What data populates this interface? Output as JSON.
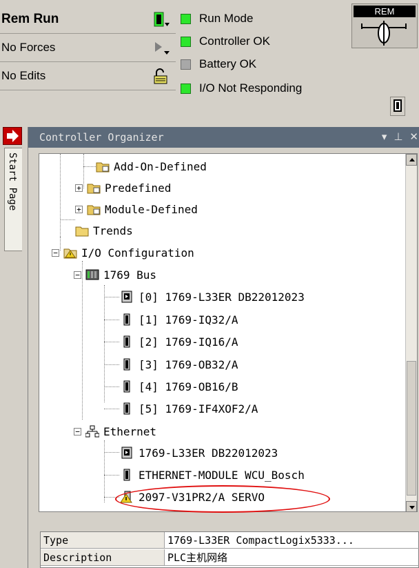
{
  "status": {
    "mode": "Rem Run",
    "forces": "No Forces",
    "edits": "No Edits",
    "leds": [
      {
        "label": "Run Mode",
        "color": "#2ce62c"
      },
      {
        "label": "Controller OK",
        "color": "#2ce62c"
      },
      {
        "label": "Battery OK",
        "color": "#a8a8a8"
      },
      {
        "label": "I/O Not Responding",
        "color": "#2ce62c"
      }
    ],
    "keyswitch_label": "REM"
  },
  "side_tab": {
    "label": "Start Page"
  },
  "organizer": {
    "title": "Controller Organizer",
    "title_buttons": [
      "▾",
      "⊥",
      "✕"
    ],
    "tree": {
      "add_on_defined": "Add-On-Defined",
      "predefined": "Predefined",
      "module_defined": "Module-Defined",
      "trends": "Trends",
      "io_config": "I/O Configuration",
      "bus": "1769 Bus",
      "bus_modules": [
        "[0] 1769-L33ER DB22012023",
        "[1] 1769-IQ32/A",
        "[2] 1769-IQ16/A",
        "[3] 1769-OB32/A",
        "[4] 1769-OB16/B",
        "[5] 1769-IF4XOF2/A"
      ],
      "ethernet": "Ethernet",
      "ethernet_modules": [
        "1769-L33ER DB22012023",
        "ETHERNET-MODULE WCU_Bosch",
        "2097-V31PR2/A SERVO"
      ]
    }
  },
  "properties": [
    {
      "key": "Type",
      "value": "1769-L33ER CompactLogix5333..."
    },
    {
      "key": "Description",
      "value": "PLC主机网络"
    }
  ]
}
